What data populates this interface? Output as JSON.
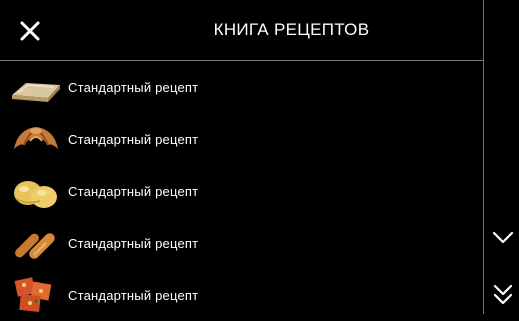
{
  "header": {
    "title": "КНИГА  РЕЦЕПТОВ",
    "close_icon": "close-icon"
  },
  "recipes": [
    {
      "label": "Стандартный  рецепт",
      "icon": "flat-bread-icon"
    },
    {
      "label": "Стандартный  рецепт",
      "icon": "croissant-icon"
    },
    {
      "label": "Стандартный  рецепт",
      "icon": "buns-icon"
    },
    {
      "label": "Стандартный  рецепт",
      "icon": "baguette-icon"
    },
    {
      "label": "Стандартный  рецепт",
      "icon": "pizza-icon"
    }
  ],
  "nav": {
    "scroll_down_icon": "chevron-down-icon",
    "page_down_icon": "double-chevron-down-icon"
  },
  "colors": {
    "background": "#000000",
    "text": "#ffffff",
    "divider": "#7a7a7a"
  }
}
